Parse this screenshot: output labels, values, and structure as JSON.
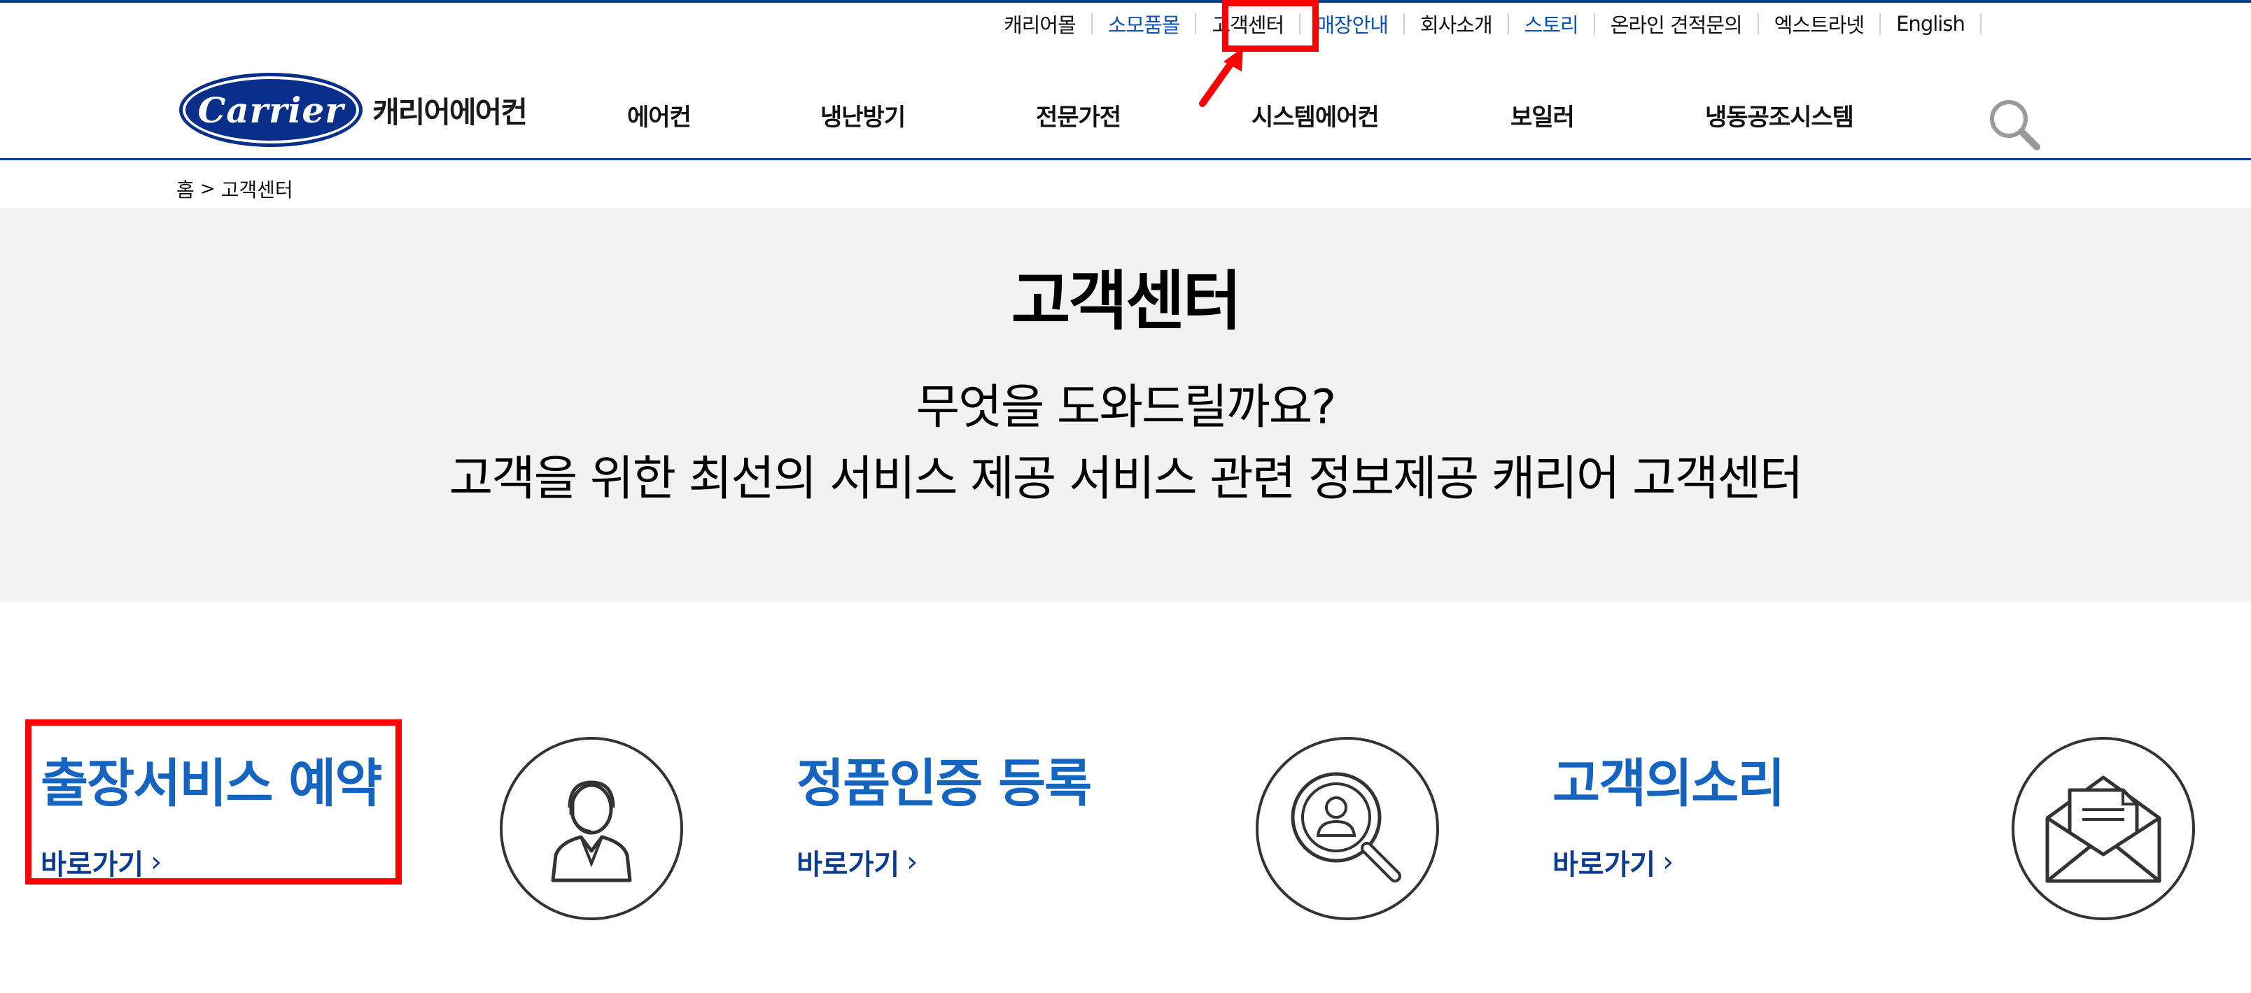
{
  "utility_nav": [
    {
      "label": "캐리어몰",
      "color": "#111111"
    },
    {
      "label": "소모품몰",
      "color": "#0a52b3"
    },
    {
      "label": "고객센터",
      "color": "#111111"
    },
    {
      "label": "매장안내",
      "color": "#0a52b3"
    },
    {
      "label": "회사소개",
      "color": "#111111"
    },
    {
      "label": "스토리",
      "color": "#0a52b3"
    },
    {
      "label": "온라인 견적문의",
      "color": "#111111"
    },
    {
      "label": "엑스트라넷",
      "color": "#111111"
    },
    {
      "label": "English",
      "color": "#111111"
    }
  ],
  "logo": {
    "brand": "Carrier",
    "korean": "캐리어에어컨"
  },
  "main_nav": [
    "에어컨",
    "냉난방기",
    "전문가전",
    "시스템에어컨",
    "보일러",
    "냉동공조시스템"
  ],
  "breadcrumb": {
    "home": "홈",
    "separator": ">",
    "current": "고객센터"
  },
  "hero": {
    "title": "고객센터",
    "subtitle_1": "무엇을 도와드릴까요?",
    "subtitle_2": "고객을 위한 최선의 서비스 제공 서비스 관련 정보제공 캐리어 고객센터"
  },
  "services": [
    {
      "title": "출장서비스 예약",
      "link": "바로가기",
      "icon": "customer-service-agent-icon"
    },
    {
      "title": "정품인증 등록",
      "link": "바로가기",
      "icon": "magnifier-person-icon"
    },
    {
      "title": "고객의소리",
      "link": "바로가기",
      "icon": "envelope-letter-icon"
    }
  ],
  "colors": {
    "accent": "#1565c0",
    "brand_navy": "#0b3b8f",
    "highlight": "#ff0000",
    "hero_bg": "#f2f2f2"
  }
}
